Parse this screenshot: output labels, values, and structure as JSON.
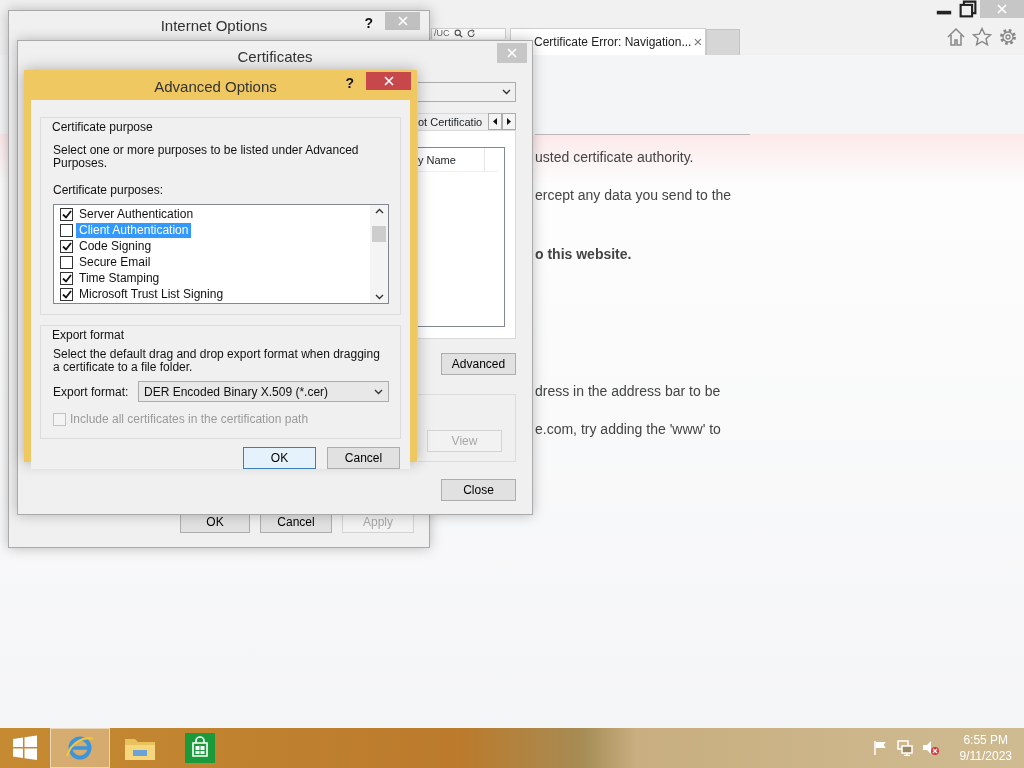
{
  "browser": {
    "address_fragment": "/UC",
    "tab": {
      "title": "Certificate Error: Navigation...",
      "close": "×"
    },
    "content": [
      {
        "text": "usted certificate authority.",
        "bold": false
      },
      {
        "text": "ercept any data you send to the",
        "bold": false
      },
      {
        "text": "o this website.",
        "bold": true
      },
      {
        "text": "dress in the address bar to be",
        "bold": false
      },
      {
        "text": "e.com, try adding the 'www' to",
        "bold": false
      }
    ]
  },
  "internet_options": {
    "title": "Internet Options",
    "help": "?",
    "buttons": [
      {
        "label": "OK",
        "disabled": false
      },
      {
        "label": "Cancel",
        "disabled": false
      },
      {
        "label": "Apply",
        "disabled": true
      }
    ]
  },
  "certificates": {
    "title": "Certificates",
    "tab_label": "ot Certificatio",
    "column_header": "y Name",
    "buttons": [
      {
        "label": "Advanced",
        "disabled": false
      },
      {
        "label": "View",
        "disabled": true
      },
      {
        "label": "Close",
        "disabled": false
      }
    ]
  },
  "advanced_options": {
    "title": "Advanced Options",
    "help": "?",
    "purpose_group": {
      "legend": "Certificate purpose",
      "description": "Select one or more purposes to be listed under Advanced Purposes.",
      "list_label": "Certificate purposes:",
      "purposes": [
        {
          "label": "Server Authentication",
          "checked": true,
          "selected": false
        },
        {
          "label": "Client Authentication",
          "checked": false,
          "selected": true
        },
        {
          "label": "Code Signing",
          "checked": true,
          "selected": false
        },
        {
          "label": "Secure Email",
          "checked": false,
          "selected": false
        },
        {
          "label": "Time Stamping",
          "checked": true,
          "selected": false
        },
        {
          "label": "Microsoft Trust List Signing",
          "checked": true,
          "selected": false
        }
      ]
    },
    "export_group": {
      "legend": "Export format",
      "description": "Select the default drag and drop export format when dragging a certificate to a file folder.",
      "format_label": "Export format:",
      "format_value": "DER Encoded Binary X.509 (*.cer)",
      "include_all": {
        "label": "Include all certificates in the certification path",
        "checked": false,
        "disabled": true
      }
    },
    "buttons": [
      {
        "label": "OK",
        "default": true
      },
      {
        "label": "Cancel",
        "default": false
      }
    ]
  },
  "taskbar": {
    "apps": [
      {
        "kind": "browser",
        "active": true
      },
      {
        "kind": "folder",
        "active": false
      },
      {
        "kind": "store",
        "active": false
      }
    ],
    "time": "6:55 PM",
    "date": "9/11/2023"
  }
}
